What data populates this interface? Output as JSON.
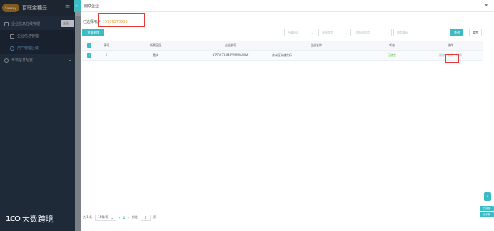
{
  "app": {
    "logo_text": "Sankey",
    "title": "百旺金穗云",
    "menu_icon": "hamburger-icon"
  },
  "sidebar": {
    "items": [
      {
        "label": "企业信息在线管理",
        "icon": "grid-icon"
      },
      {
        "label": "企业信息管理",
        "icon": "building-icon"
      },
      {
        "label": "用户管理区域 ",
        "icon": "user-icon"
      },
      {
        "label": "专项信息配置",
        "icon": "gear-icon"
      }
    ]
  },
  "background": {
    "tab_label": "企业"
  },
  "modal": {
    "title": "関联企业",
    "close": "×",
    "selected_label": "已选择用户:",
    "selected_value": "15736373535",
    "batch_delete": "批量删除",
    "filters": [
      {
        "placeholder": "所属区区"
      },
      {
        "placeholder": "强制状态"
      },
      {
        "placeholder": "增值税类型"
      },
      {
        "placeholder": "税务编码"
      }
    ],
    "search_label": "查询",
    "reset_label": "重置"
  },
  "table": {
    "headers": [
      "序号",
      "所属区区",
      "企业税号",
      "企业名称",
      "状态",
      "操作"
    ],
    "rows": [
      {
        "index": "1",
        "region": "重庆",
        "tax_no": "92500234MA5YDW6UXW",
        "name": "齐州区光谱实行",
        "status": "已绑定",
        "ops": [
          "删除",
          "编辑",
          "详情"
        ]
      }
    ]
  },
  "pagination": {
    "total": "共 1 条",
    "page_size": "15条/页",
    "prev": "‹",
    "current": "1",
    "next": "›",
    "goto_label": "前往",
    "goto_value": "1",
    "page_suffix": "页"
  },
  "float": {
    "arrow": "‹",
    "tag1": "已阅读",
    "tag2": "已识别"
  },
  "watermark": {
    "logo": "1CO",
    "text": "大数跨境"
  },
  "colors": {
    "accent": "#3bbbc4",
    "highlight": "#e53935",
    "selected_value": "#e99a3b",
    "status": "#67c23a"
  }
}
